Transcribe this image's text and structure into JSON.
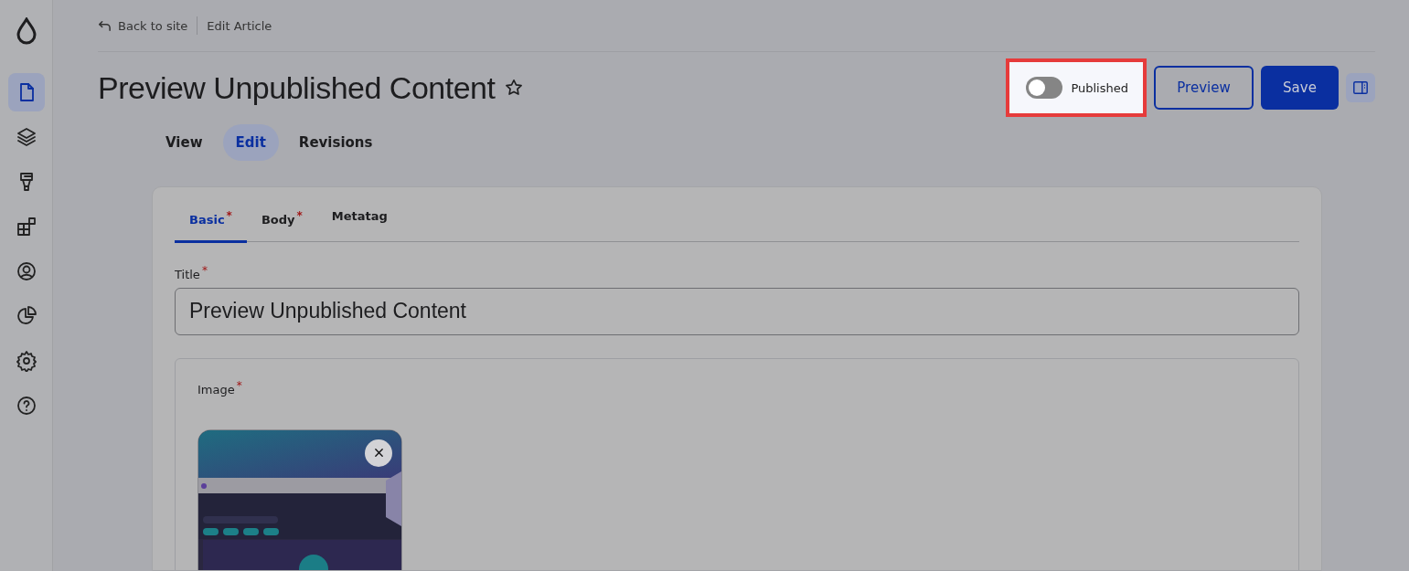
{
  "sidebar": {
    "items": [
      {
        "selected": true
      },
      {
        "selected": false
      },
      {
        "selected": false
      },
      {
        "selected": false
      },
      {
        "selected": false
      },
      {
        "selected": false
      },
      {
        "selected": false
      },
      {
        "selected": false
      }
    ]
  },
  "breadcrumb": {
    "back": "Back to site",
    "current": "Edit Article"
  },
  "page_title": "Preview Unpublished Content",
  "status_toggle": {
    "label": "Published",
    "on": false,
    "highlighted": true
  },
  "buttons": [
    {
      "label": "Preview",
      "kind": "secondary"
    },
    {
      "label": "Save",
      "kind": "primary"
    }
  ],
  "tabs": [
    {
      "label": "View",
      "selected": false
    },
    {
      "label": "Edit",
      "selected": true
    },
    {
      "label": "Revisions",
      "selected": false
    }
  ],
  "form_tabs": [
    {
      "label": "Basic",
      "required_mark": "*",
      "selected": true
    },
    {
      "label": "Body",
      "required_mark": "*",
      "selected": false
    },
    {
      "label": "Metatag",
      "selected": false
    }
  ],
  "title_field": {
    "label": "Title",
    "required_mark": "*",
    "value": "Preview Unpublished Content"
  },
  "image_field": {
    "label": "Image",
    "required_mark": "*"
  }
}
